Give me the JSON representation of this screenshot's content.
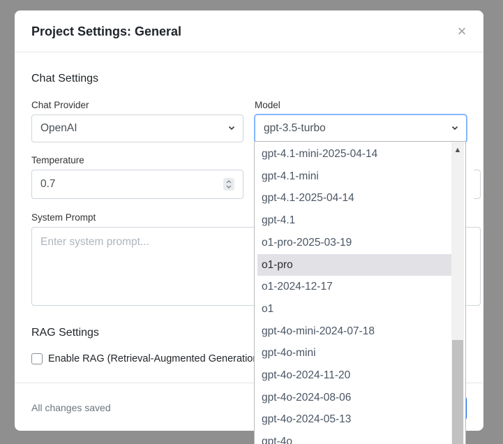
{
  "modal": {
    "title": "Project Settings: General",
    "close_icon": "×"
  },
  "chat_settings": {
    "title": "Chat Settings",
    "provider_label": "Chat Provider",
    "provider_value": "OpenAI",
    "model_label": "Model",
    "model_value": "gpt-3.5-turbo",
    "temperature_label": "Temperature",
    "temperature_value": "0.7",
    "system_prompt_label": "System Prompt",
    "system_prompt_placeholder": "Enter system prompt..."
  },
  "rag_settings": {
    "title": "RAG Settings",
    "enable_rag_label": "Enable RAG (Retrieval-Augmented Generation)",
    "enable_rag_checked": false
  },
  "footer": {
    "status_text": "All changes saved"
  },
  "model_dropdown": {
    "options": [
      "gpt-4.1-mini-2025-04-14",
      "gpt-4.1-mini",
      "gpt-4.1-2025-04-14",
      "gpt-4.1",
      "o1-pro-2025-03-19",
      "o1-pro",
      "o1-2024-12-17",
      "o1",
      "gpt-4o-mini-2024-07-18",
      "gpt-4o-mini",
      "gpt-4o-2024-11-20",
      "gpt-4o-2024-08-06",
      "gpt-4o-2024-05-13",
      "gpt-4o"
    ],
    "highlighted_option": "o1-pro"
  },
  "icons": {
    "close": "close-icon",
    "chevron": "chevron-down-icon",
    "spinner": "spinner-icon",
    "scroll_up": "scroll-up-arrow-icon"
  }
}
